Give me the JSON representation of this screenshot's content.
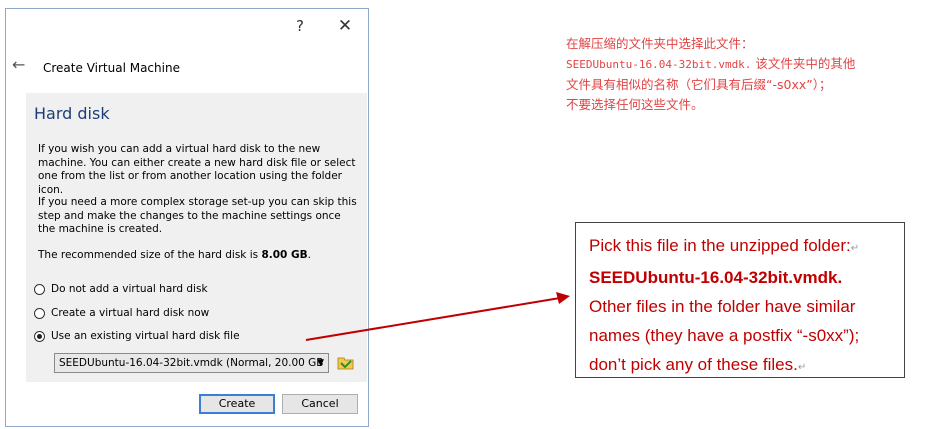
{
  "dialog": {
    "help_icon": "?",
    "close_icon": "✕",
    "back_icon": "←",
    "nav_title": "Create Virtual Machine",
    "heading": "Hard disk",
    "para1": "If you wish you can add a virtual hard disk to the new machine. You can either create a new hard disk file or select one from the list or from another location using the folder icon.",
    "para2": "If you need a more complex storage set-up you can skip this step and make the changes to the machine settings once the machine is created.",
    "recommended_prefix": "The recommended size of the hard disk is ",
    "recommended_size": "8.00 GB",
    "recommended_suffix": ".",
    "options": [
      {
        "label": "Do not add a virtual hard disk",
        "selected": false
      },
      {
        "label": "Create a virtual hard disk now",
        "selected": false
      },
      {
        "label": "Use an existing virtual hard disk file",
        "selected": true
      }
    ],
    "disk_select_value": "SEEDUbuntu-16.04-32bit.vmdk (Normal, 20.00 GB",
    "create_label": "Create",
    "cancel_label": "Cancel"
  },
  "note_zh": {
    "line1_text": "在解压缩的文件夹中选择此文件：",
    "line2_file": "SEEDUbuntu-16.04-32bit.vmdk.",
    "line2_text": " 该文件夹中的其他",
    "line3": "文件具有相似的名称（它们具有后缀“-s0xx”）；",
    "line4": "不要选择任何这些文件。"
  },
  "callout": {
    "line1": "Pick this file in the unzipped folder:",
    "line2": "SEEDUbuntu-16.04-32bit.vmdk.",
    "line3": "Other files in the folder have similar",
    "line4": "names (they have a postfix “-s0xx”);",
    "line5": "don’t pick any of these files.",
    "paragraph_mark": "↵"
  },
  "colors": {
    "annotation_red": "#c00000",
    "heading_blue": "#1c3e78",
    "default_button_border": "#3c7fd4"
  }
}
